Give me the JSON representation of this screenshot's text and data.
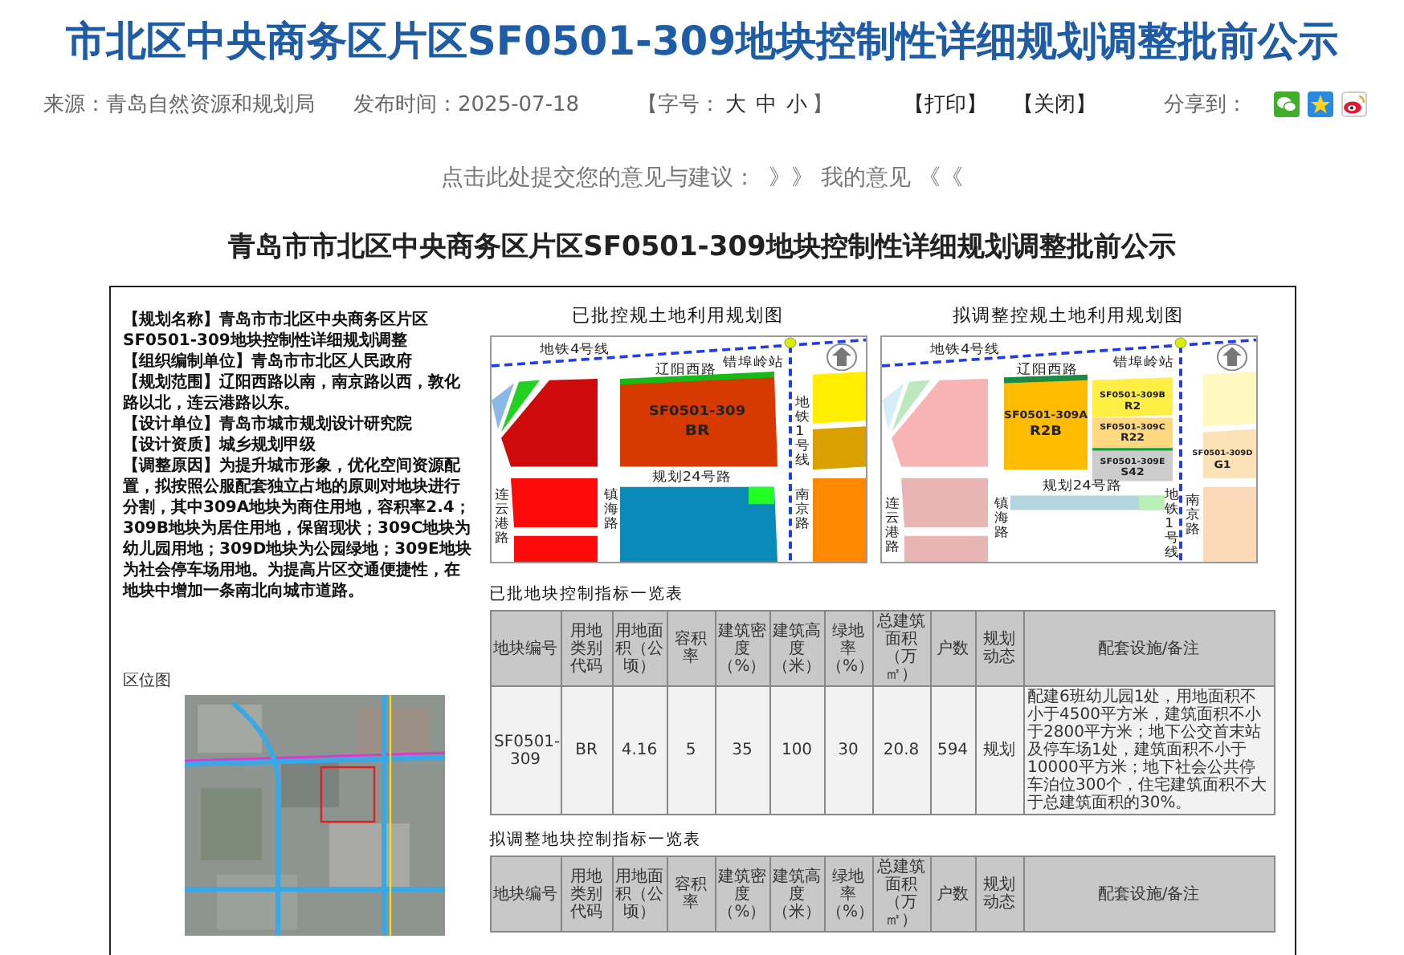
{
  "title": "市北区中央商务区片区SF0501-309地块控制性详细规划调整批前公示",
  "meta": {
    "source": "来源：青岛自然资源和规划局",
    "published": "发布时间：2025-07-18",
    "font_size": {
      "open": "【字号：",
      "sizes": [
        "大",
        "中",
        "小"
      ],
      "close": "】"
    },
    "actions": [
      "【打印】",
      "【关闭】"
    ],
    "share_label": "分享到："
  },
  "feedback": {
    "prompt": "点击此处提交您的意见与建议：",
    "link": "》》 我的意见 《《"
  },
  "notice_title": "青岛市市北区中央商务区片区SF0501-309地块控制性详细规划调整批前公示",
  "document": {
    "info": [
      {
        "label": "【规划名称】",
        "text": "青岛市市北区中央商务区片区SF0501-309地块控制性详细规划调整"
      },
      {
        "label": "【组织编制单位】",
        "text": "青岛市市北区人民政府"
      },
      {
        "label": "【规划范围】",
        "text": "辽阳西路以南，南京路以西，敦化路以北，连云港路以东。"
      },
      {
        "label": "【设计单位】",
        "text": "青岛市城市规划设计研究院"
      },
      {
        "label": "【设计资质】",
        "text": "城乡规划甲级"
      },
      {
        "label": "【调整原因】",
        "text": "为提升城市形象，优化空间资源配置，拟按照公服配套独立占地的原则对地块进行分割，其中309A地块为商住用地，容积率2.4；309B地块为居住用地，保留现状；309C地块为幼儿园用地；309D地块为公园绿地；309E地块为社会停车场用地。为提高片区交通便捷性，在地块中增加一条南北向城市道路。"
      }
    ],
    "location_map": {
      "label": "区位图"
    },
    "maps": [
      {
        "kind": "approved",
        "title": "已批控规土地利用规划图",
        "labels": [
          "地铁4号线",
          "辽阳西路",
          "错埠岭站",
          "SF0501-309",
          "BR",
          "地铁1号线",
          "规划24号路",
          "连云港路",
          "镇海路",
          "南京路"
        ]
      },
      {
        "kind": "proposed",
        "title": "拟调整控规土地利用规划图",
        "labels": [
          "地铁4号线",
          "辽阳西路",
          "错埠岭站",
          "SF0501-309A",
          "R2B",
          "SF0501-309B",
          "R2",
          "SF0501-309C",
          "R22",
          "SF0501-309D",
          "G1",
          "SF0501-309E",
          "S42",
          "规划24号路",
          "连云港路",
          "镇海路",
          "地铁1号线",
          "南京路"
        ]
      }
    ],
    "tables": [
      {
        "title": "已批地块控制指标一览表",
        "columns": [
          "地块编号",
          "用地类别代码",
          "用地面积（公顷）",
          "容积率",
          "建筑密度（%）",
          "建筑高度（米）",
          "绿地率（%）",
          "总建筑面积（万㎡）",
          "户数",
          "规划动态",
          "配套设施/备注"
        ],
        "rows": [
          [
            "SF0501-309",
            "BR",
            "4.16",
            "5",
            "35",
            "100",
            "30",
            "20.8",
            "594",
            "规划",
            "配建6班幼儿园1处，用地面积不小于4500平方米，建筑面积不小于2800平方米；地下公交首末站及停车场1处，建筑面积不小于10000平方米；地下社会公共停车泊位300个，住宅建筑面积不大于总建筑面积的30%。"
          ]
        ]
      },
      {
        "title": "拟调整地块控制指标一览表",
        "columns": [
          "地块编号",
          "用地类别代码",
          "用地面积（公顷）",
          "容积率",
          "建筑密度（%）",
          "建筑高度（米）",
          "绿地率（%）",
          "总建筑面积（万㎡）",
          "户数",
          "规划动态",
          "配套设施/备注"
        ]
      }
    ]
  }
}
